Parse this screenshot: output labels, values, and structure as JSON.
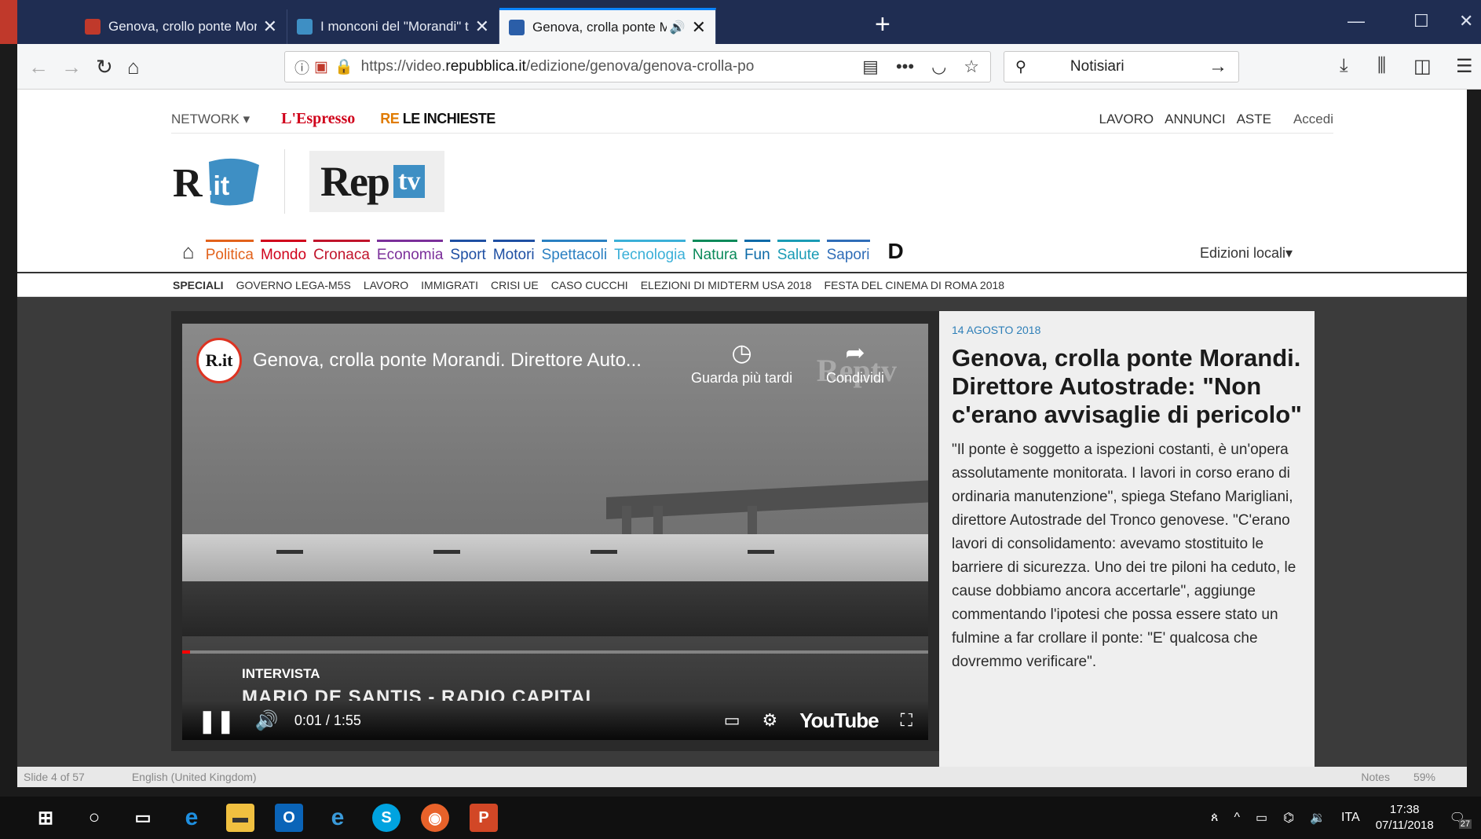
{
  "browser": {
    "tabs": [
      {
        "title": "Genova, crollo ponte Morandi",
        "favicon_color": "#c0392b"
      },
      {
        "title": "I monconi del \"Morandi\" trasfe",
        "favicon_color": "#3e8fc4"
      },
      {
        "title": "Genova, crolla ponte Moran",
        "favicon_color": "#2b5ea8",
        "audio": "🔊"
      }
    ],
    "close_glyph": "✕",
    "new_tab_glyph": "+",
    "url": "https://video.repubblica.it/edizione/genova/genova-crolla-po",
    "url_domain": "repubblica.it",
    "url_prefix": "https://video.",
    "url_suffix": "/edizione/genova/genova-crolla-po",
    "search_text": "Notisiari"
  },
  "site": {
    "network_label": "NETWORK ▾",
    "espresso": "L'Espresso",
    "inchieste_prefix": "RE",
    "inchieste": "LE INCHIESTE",
    "top_links": [
      "LAVORO",
      "ANNUNCI",
      "ASTE"
    ],
    "login": "Accedi",
    "rit_logo": "R.it",
    "rep": "Rep",
    "tv": "tv",
    "sections": [
      {
        "label": "Politica",
        "color": "#e2621b"
      },
      {
        "label": "Mondo",
        "color": "#d0021b"
      },
      {
        "label": "Cronaca",
        "color": "#c0142b"
      },
      {
        "label": "Economia",
        "color": "#7b2f9a"
      },
      {
        "label": "Sport",
        "color": "#1e4fa3"
      },
      {
        "label": "Motori",
        "color": "#1e4fa3"
      },
      {
        "label": "Spettacoli",
        "color": "#2a80c2"
      },
      {
        "label": "Tecnologia",
        "color": "#3bb0d8"
      },
      {
        "label": "Natura",
        "color": "#0a8a5a"
      },
      {
        "label": "Fun",
        "color": "#0b6aa8"
      },
      {
        "label": "Salute",
        "color": "#1a9bb5"
      },
      {
        "label": "Sapori",
        "color": "#2f6db8"
      }
    ],
    "d_logo": "D",
    "edizioni": "Edizioni locali▾",
    "speciali_label": "SPECIALI",
    "speciali": [
      "GOVERNO LEGA-M5S",
      "LAVORO",
      "IMMIGRATI",
      "CRISI UE",
      "CASO CUCCHI",
      "ELEZIONI DI MIDTERM USA 2018",
      "FESTA DEL CINEMA DI ROMA 2018"
    ]
  },
  "video": {
    "title": "Genova, crolla ponte Morandi. Direttore Auto...",
    "watch_later": "Guarda più tardi",
    "share": "Condividi",
    "watermark": "Reptv",
    "kicker": "INTERVISTA",
    "name": "MARIO DE SANTIS - RADIO CAPITAL",
    "time": "0:01 / 1:55",
    "youtube": "YouTube",
    "progress": 0.01
  },
  "article": {
    "date": "14 AGOSTO 2018",
    "headline": "Genova, crolla ponte Morandi. Direttore Autostrade: \"Non c'erano avvisaglie di pericolo\"",
    "body": "\"Il ponte è soggetto a ispezioni costanti, è un'opera assolutamente monitorata. I lavori in corso erano di ordinaria manutenzione\", spiega Stefano Marigliani, direttore Autostrade del Tronco genovese. \"C'erano lavori di consolidamento: avevamo stostituito le barriere di sicurezza. Uno dei tre piloni ha ceduto, le cause dobbiamo ancora accertarle\", aggiunge commentando l'ipotesi che possa essere stato un fulmine a far crollare il ponte: \"E' qualcosa che dovremmo verificare\"."
  },
  "ppt": {
    "slide": "Slide 4 of 57",
    "language": "English (United Kingdom)",
    "notes": "Notes",
    "zoom": "59%"
  },
  "taskbar": {
    "language": "ITA",
    "time": "17:38",
    "date": "07/11/2018",
    "notifications": "27"
  }
}
